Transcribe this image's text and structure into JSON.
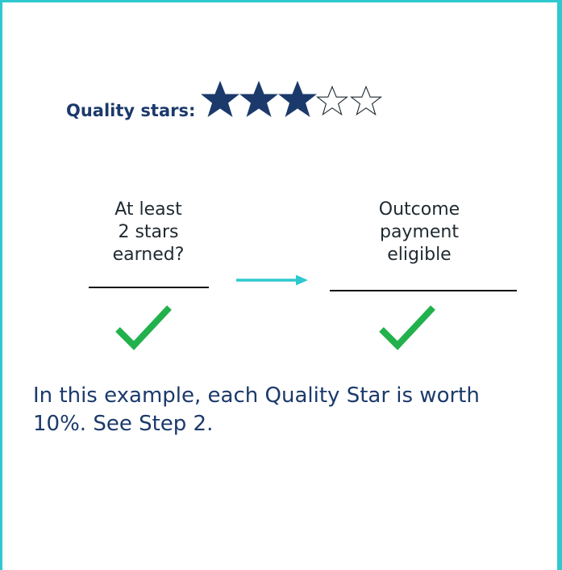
{
  "quality": {
    "label": "Quality stars:",
    "stars_earned": 3,
    "stars_total": 5
  },
  "steps": {
    "condition": {
      "line1": "At least",
      "line2": "2 stars",
      "line3": "earned?"
    },
    "result": {
      "line1": "Outcome",
      "line2": "payment",
      "line3": "eligible"
    }
  },
  "note": {
    "line1": "In this example, each Quality Star is worth",
    "line2": "10%.  See Step 2."
  },
  "icons": {
    "filled_star": "filled-star-icon",
    "empty_star": "empty-star-icon",
    "arrow": "arrow-right-icon",
    "check": "checkmark-icon"
  },
  "colors": {
    "border": "#2ec8cf",
    "navy": "#1b3a6b",
    "check_green": "#22b14c",
    "arrow": "#2ec8cf"
  }
}
